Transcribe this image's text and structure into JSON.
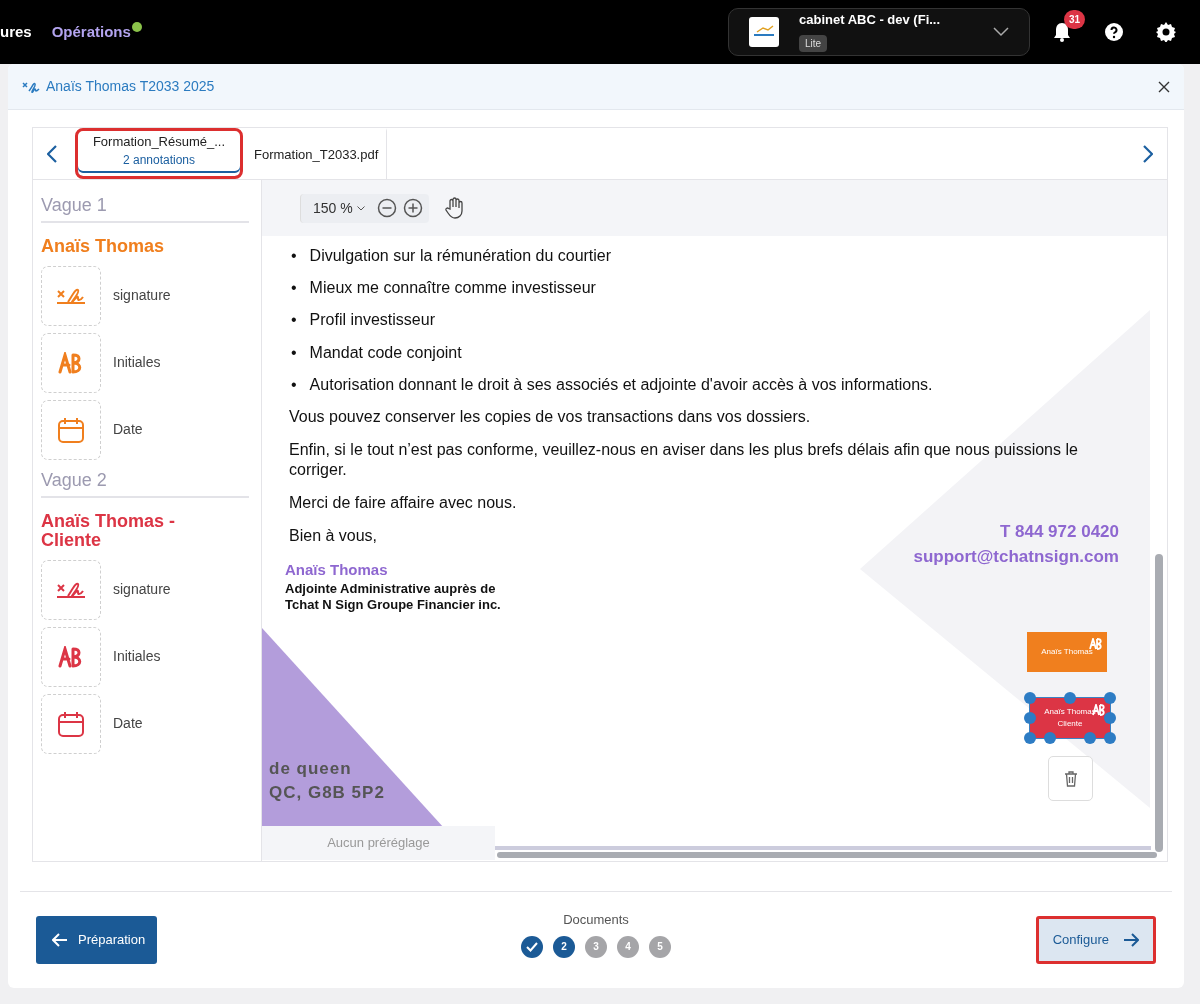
{
  "topbar": {
    "nav": [
      {
        "label": "ures",
        "selected": false,
        "dot": false
      },
      {
        "label": "Opérations",
        "selected": true,
        "dot": true
      }
    ],
    "account": {
      "name": "cabinet ABC - dev (Fi...",
      "plan": "Lite"
    },
    "notifications": "31"
  },
  "modal": {
    "title": "Anaïs Thomas T2033 2025",
    "tabs": [
      {
        "title": "Formation_Résumé_...",
        "subtitle": "2 annotations",
        "selected": true,
        "highlighted": true
      },
      {
        "title": "Formation_T2033.pdf",
        "selected": false,
        "highlighted": false
      }
    ],
    "waves": [
      {
        "title": "Vague 1",
        "signers": [
          {
            "name": "Anaïs Thomas",
            "color": "#f07f1e",
            "fields": [
              {
                "kind": "signature",
                "label": "signature"
              },
              {
                "kind": "initials",
                "label": "Initiales"
              },
              {
                "kind": "date",
                "label": "Date"
              }
            ]
          }
        ]
      },
      {
        "title": "Vague 2",
        "signers": [
          {
            "name": "Anaïs Thomas - Cliente",
            "color": "#dc3545",
            "fields": [
              {
                "kind": "signature",
                "label": "signature"
              },
              {
                "kind": "initials",
                "label": "Initiales"
              },
              {
                "kind": "date",
                "label": "Date"
              }
            ]
          }
        ]
      }
    ],
    "zoom": "150 %",
    "document": {
      "bullets": [
        {
          "marker": "•",
          "text": "Divulgation sur la rémunération du courtier"
        },
        {
          "marker": "•",
          "text": "Mieux me connaître comme investisseur"
        },
        {
          "marker": "•",
          "text": "Profil investisseur"
        },
        {
          "marker": "•",
          "text": "Mandat code conjoint"
        },
        {
          "marker": "•",
          "text": "Autorisation donnant le droit à ses associés et adjointe d'avoir accès à vos informations."
        }
      ],
      "paragraphs": [
        "Vous pouvez conserver les copies de vos transactions dans vos dossiers.",
        "Enfin, si le tout n’est pas conforme, veuillez-nous en aviser dans les plus brefs délais afin que nous puissions le corriger.",
        "Merci de faire affaire avec nous.",
        "Bien à vous,"
      ],
      "signer_name": "Anaïs Thomas",
      "signer_title": "Adjointe Administrative auprès de Tchat N Sign Groupe Financier inc.",
      "address": [
        "de queen",
        "QC, G8B 5P2"
      ],
      "phone": "T 844 972 0420",
      "email": "support@tchatnsign.com",
      "annotations": [
        {
          "lines": [
            "Anaïs Thomas"
          ],
          "color": "#f07f1e",
          "selected": false
        },
        {
          "lines": [
            "Anaïs Thomas",
            "Cliente"
          ],
          "color": "#dc3545",
          "selected": true
        }
      ],
      "preset": "Aucun préréglage"
    },
    "footer": {
      "back": "Préparation",
      "steps_label": "Documents",
      "steps": [
        {
          "done": true,
          "reached": true
        },
        {
          "label": "2",
          "done": false,
          "reached": true
        },
        {
          "label": "3",
          "done": false,
          "reached": false
        },
        {
          "label": "4",
          "done": false,
          "reached": false
        },
        {
          "label": "5",
          "done": false,
          "reached": false
        }
      ],
      "next": {
        "label": "Configure",
        "highlighted": true
      }
    }
  }
}
